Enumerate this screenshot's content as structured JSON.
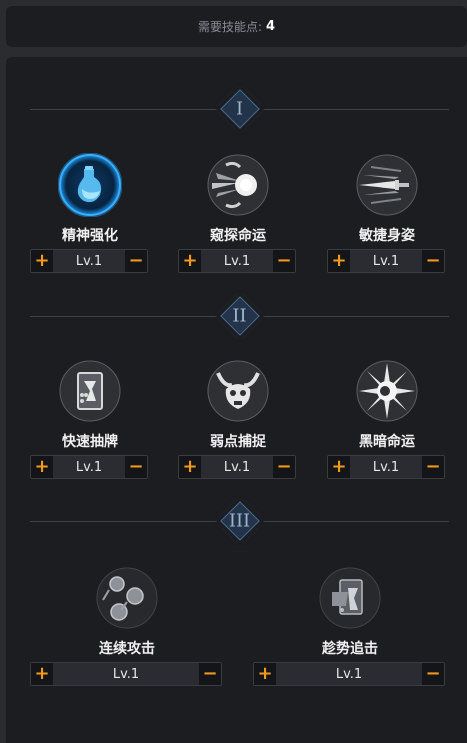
{
  "header": {
    "label": "需要技能点:",
    "points": "4"
  },
  "tiers": [
    {
      "numeral": "I"
    },
    {
      "numeral": "II"
    },
    {
      "numeral": "III"
    }
  ],
  "skills": [
    {
      "name": "精神强化",
      "level": "Lv.1",
      "icon": "potion-flask-icon",
      "active": true
    },
    {
      "name": "窥探命运",
      "level": "Lv.1",
      "icon": "orb-burst-icon"
    },
    {
      "name": "敏捷身姿",
      "level": "Lv.1",
      "icon": "dagger-dash-icon"
    },
    {
      "name": "快速抽牌",
      "level": "Lv.1",
      "icon": "card-draw-icon"
    },
    {
      "name": "弱点捕捉",
      "level": "Lv.1",
      "icon": "horned-skull-icon"
    },
    {
      "name": "黑暗命运",
      "level": "Lv.1",
      "icon": "dark-burst-icon"
    },
    {
      "name": "连续攻击",
      "level": "Lv.1",
      "icon": "triple-strike-icon"
    },
    {
      "name": "趁势追击",
      "level": "Lv.1",
      "icon": "card-pursuit-icon"
    }
  ],
  "controls": {
    "plus": "+",
    "minus": "−"
  },
  "colors": {
    "accent": "#f39a1e",
    "active_glow": "#2fa8ff",
    "tier_diamond": "#23344a"
  }
}
